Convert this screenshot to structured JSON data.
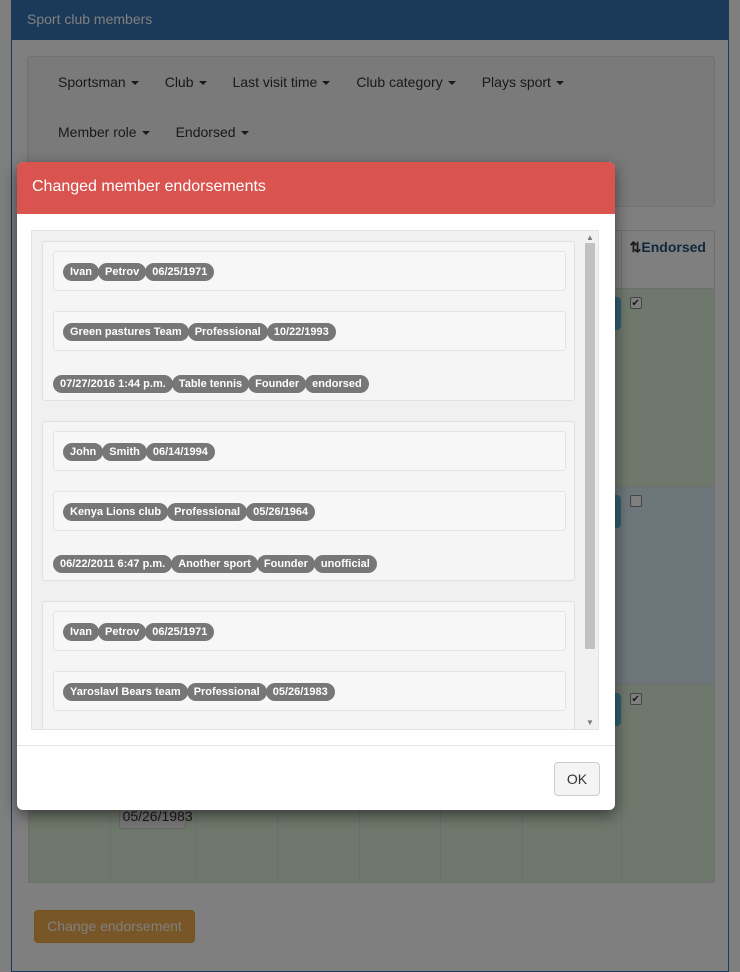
{
  "panel": {
    "title": "Sport club members"
  },
  "filters": [
    {
      "label": "Sportsman"
    },
    {
      "label": "Club"
    },
    {
      "label": "Last visit time"
    },
    {
      "label": "Club category"
    },
    {
      "label": "Plays sport"
    },
    {
      "label": "Member role"
    },
    {
      "label": "Endorsed"
    }
  ],
  "table": {
    "endorsed_header": "Endorsed",
    "rows": [
      {
        "endorsed": true,
        "color": "#dff0d8"
      },
      {
        "endorsed": false,
        "color": "#d9edf7"
      },
      {
        "endorsed": true,
        "color": "#dff0d8",
        "club_date": "05/26/1983"
      }
    ]
  },
  "change_button": "Change endorsement",
  "modal": {
    "title": "Changed member endorsements",
    "ok": "OK",
    "entries": [
      {
        "person": [
          "Ivan",
          "Petrov",
          "06/25/1971"
        ],
        "club": [
          "Green pastures Team",
          "Professional",
          "10/22/1993"
        ],
        "details": [
          "07/27/2016 1:44 p.m.",
          "Table tennis",
          "Founder",
          "endorsed"
        ]
      },
      {
        "person": [
          "John",
          "Smith",
          "06/14/1994"
        ],
        "club": [
          "Kenya Lions club",
          "Professional",
          "05/26/1964"
        ],
        "details": [
          "06/22/2011 6:47 p.m.",
          "Another sport",
          "Founder",
          "unofficial"
        ]
      },
      {
        "person": [
          "Ivan",
          "Petrov",
          "06/25/1971"
        ],
        "club": [
          "Yaroslavl Bears team",
          "Professional",
          "05/26/1983"
        ]
      }
    ]
  },
  "colors": {
    "primary": "#3672b3",
    "danger": "#d9534f",
    "warning": "#f0ad4e",
    "info": "#5bc0de",
    "badge": "#777777"
  }
}
